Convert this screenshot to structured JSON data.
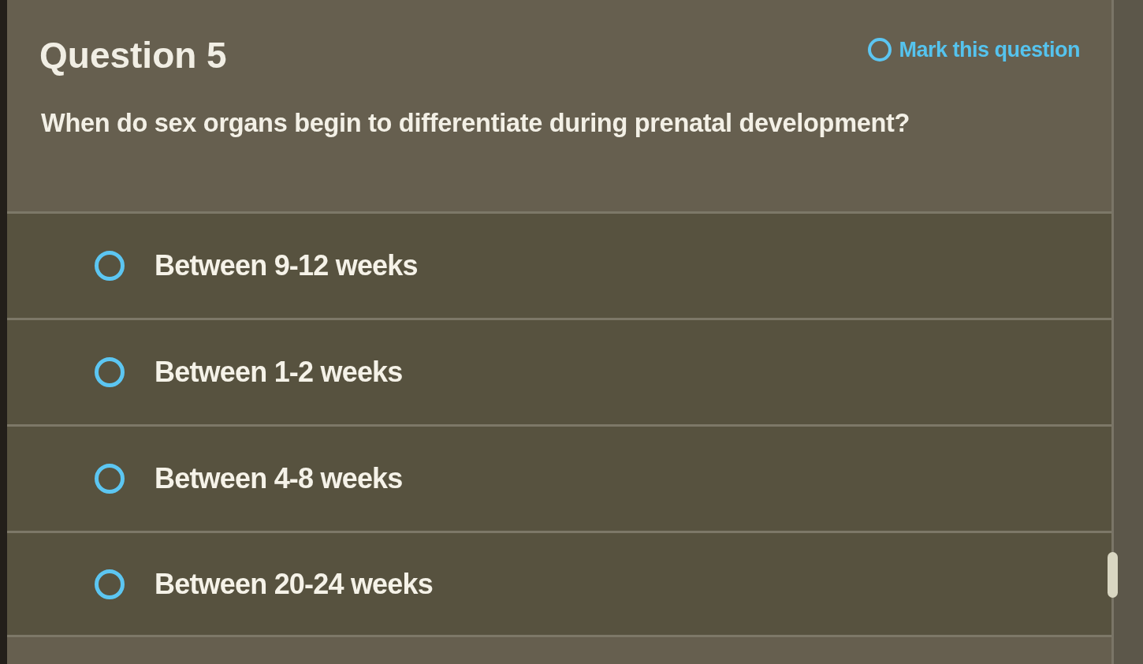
{
  "question": {
    "title": "Question 5",
    "mark": {
      "label": "Mark this question",
      "marked": false
    },
    "text": "When do sex organs begin to differentiate during prenatal development?"
  },
  "options": [
    {
      "label": "Between 9-12 weeks",
      "selected": false
    },
    {
      "label": "Between 1-2 weeks",
      "selected": false
    },
    {
      "label": "Between 4-8 weeks",
      "selected": false
    },
    {
      "label": "Between 20-24 weeks",
      "selected": false
    }
  ]
}
